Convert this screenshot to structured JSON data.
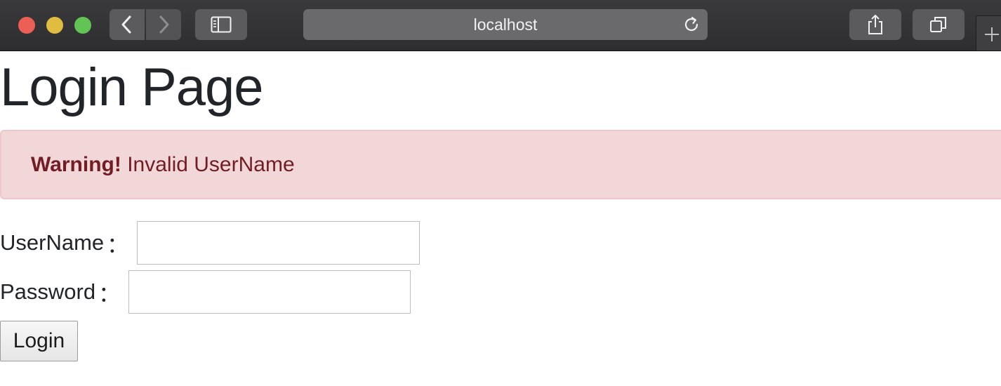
{
  "browser": {
    "address": "localhost",
    "icons": {
      "back": "chevron-left-icon",
      "forward": "chevron-right-icon",
      "sidebar": "sidebar-icon",
      "reload": "reload-icon",
      "share": "share-icon",
      "tabs": "tabs-overview-icon",
      "new_tab": "plus-icon"
    }
  },
  "page": {
    "title": "Login Page",
    "alert": {
      "strong": "Warning!",
      "message": " Invalid UserName",
      "background": "#f2d7d9",
      "text_color": "#721c24"
    },
    "form": {
      "username_label": "UserName",
      "password_label": "Password",
      "colon": "：",
      "username_value": "",
      "password_value": "",
      "submit_label": "Login"
    }
  }
}
